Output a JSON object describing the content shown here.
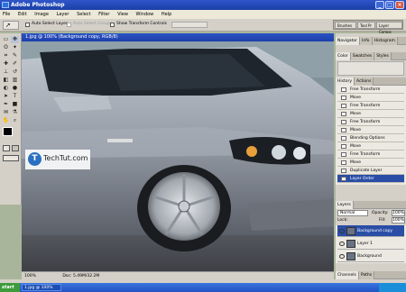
{
  "app": {
    "title": "Adobe Photoshop"
  },
  "menu": [
    "File",
    "Edit",
    "Image",
    "Layer",
    "Select",
    "Filter",
    "View",
    "Window",
    "Help"
  ],
  "options": {
    "auto_select_layer": "Auto Select Layer",
    "auto_select_groups": "Auto Select Groups",
    "show_transform_controls": "Show Transform Controls"
  },
  "palette_well": {
    "tabs": [
      "Brushes",
      "Tool Pr",
      "Layer Comps"
    ]
  },
  "document": {
    "title": "1.jpg @ 100% (Background copy, RGB/8)",
    "status": "Doc: 5.49M/32.2M",
    "zoom": "100%"
  },
  "watermark": {
    "site": "TechTut.com"
  },
  "panels": {
    "navigator_tabs": [
      "Navigator",
      "Info",
      "Histogram"
    ],
    "color_tabs": [
      "Color",
      "Swatches",
      "Styles"
    ],
    "history_tabs": [
      "History",
      "Actions"
    ],
    "history_items": [
      "Free Transform",
      "Move",
      "Free Transform",
      "Move",
      "Free Transform",
      "Move",
      "Blending Options",
      "Move",
      "Free Transform",
      "Move",
      "Duplicate Layer",
      "Layer Order"
    ],
    "history_selected_index": 11,
    "layers_tabs": [
      "Layers"
    ],
    "blend_mode": "Normal",
    "opacity_label": "Opacity:",
    "opacity_value": "100%",
    "lock_label": "Lock:",
    "fill_label": "Fill:",
    "fill_value": "100%",
    "layers": [
      "Background copy",
      "Layer 1",
      "Background"
    ],
    "layers_selected_index": 0,
    "bottom_tabs": [
      "Channels",
      "Paths"
    ]
  },
  "taskbar": {
    "start": "start",
    "task": "1.jpg @ 100%"
  },
  "colors": {
    "title_blue": "#1f48b8",
    "panel_gray": "#d4d0c8",
    "selection_blue": "#2a4ea6",
    "car_silver": "#9aa2ad"
  }
}
